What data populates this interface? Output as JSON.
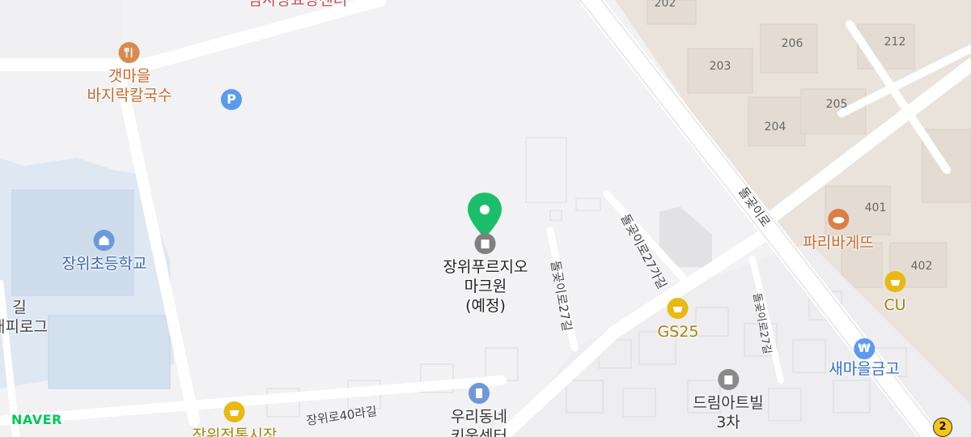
{
  "map": {
    "destination": {
      "name_line1": "장위푸르지오",
      "name_line2": "마크원",
      "name_line3": "(예정)"
    },
    "pois": [
      {
        "id": "chamsarang",
        "label": "참사랑요양센터",
        "icon": "building-icon",
        "color": "#d05a5a"
      },
      {
        "id": "gaetmaeul_line1",
        "label": "갯마을",
        "icon": "restaurant-icon",
        "color": "#c46b2a"
      },
      {
        "id": "gaetmaeul_line2",
        "label": "바지락칼국수"
      },
      {
        "id": "parking",
        "label": "P",
        "icon": "parking-icon",
        "color": "#5b9bef"
      },
      {
        "id": "school",
        "label": "장위초등학교",
        "icon": "school-icon",
        "color": "#6f98d9"
      },
      {
        "id": "gs25",
        "label": "GS25",
        "icon": "convenience-store-icon",
        "color": "#b59110"
      },
      {
        "id": "paris",
        "label": "파리바게뜨",
        "icon": "bakery-icon",
        "color": "#c46b2a"
      },
      {
        "id": "cu",
        "label": "CU",
        "icon": "convenience-store-icon",
        "color": "#b59110"
      },
      {
        "id": "saemaeul",
        "label": "새마을금고",
        "icon": "bank-icon",
        "color": "#3b7be0"
      },
      {
        "id": "dream_line1",
        "label": "드림아트빌"
      },
      {
        "id": "dream_line2",
        "label": "3차"
      },
      {
        "id": "woori_line1",
        "label": "우리동네"
      },
      {
        "id": "woori_line2",
        "label": "키움센터"
      },
      {
        "id": "market",
        "label": "장위전통시장",
        "icon": "market-icon",
        "color": "#b59110"
      },
      {
        "id": "left_road_frag",
        "label": "래피로그"
      },
      {
        "id": "left_road_frag2",
        "label": "길"
      }
    ],
    "streets": [
      "돌곶이로",
      "돌곶이로27길",
      "돌곶이로27가길",
      "장위로40라길",
      "돌곶이로27길"
    ],
    "building_numbers": [
      "202",
      "203",
      "206",
      "212",
      "204",
      "205",
      "401",
      "402"
    ],
    "route_badge": "2",
    "logo": "NAVER",
    "accent_color": "#1bbf6b"
  }
}
